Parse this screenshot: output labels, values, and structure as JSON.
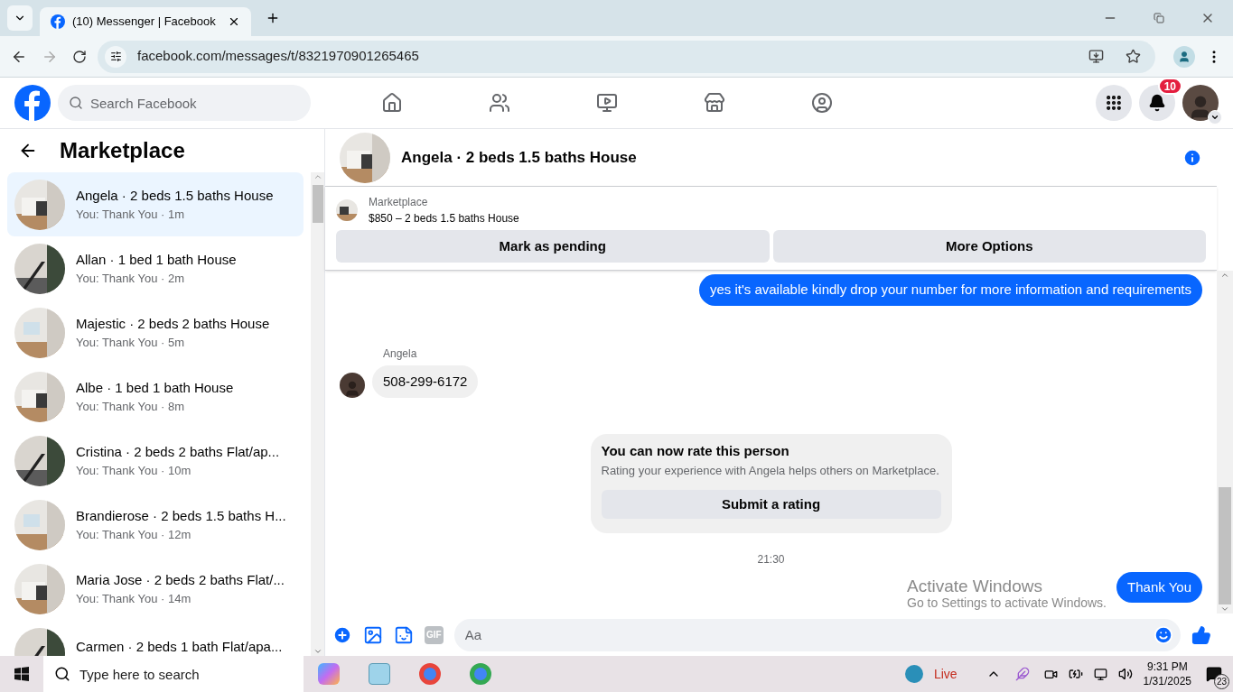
{
  "browser": {
    "tab_title": "(10) Messenger | Facebook",
    "url": "facebook.com/messages/t/8321970901265465"
  },
  "header": {
    "search_placeholder": "Search Facebook",
    "notification_count": "10"
  },
  "sidebar": {
    "title": "Marketplace",
    "conversations": [
      {
        "name": "Angela · 2 beds 1.5 baths House",
        "preview": "You: Thank You · 1m",
        "selected": true
      },
      {
        "name": "Allan · 1 bed 1 bath House",
        "preview": "You: Thank You · 2m",
        "selected": false
      },
      {
        "name": "Majestic · 2 beds 2 baths House",
        "preview": "You: Thank You · 5m",
        "selected": false
      },
      {
        "name": "Albe · 1 bed 1 bath House",
        "preview": "You: Thank You · 8m",
        "selected": false
      },
      {
        "name": "Cristina · 2 beds 2 baths Flat/ap...",
        "preview": "You: Thank You · 10m",
        "selected": false
      },
      {
        "name": "Brandierose · 2 beds 1.5 baths H...",
        "preview": "You: Thank You · 12m",
        "selected": false
      },
      {
        "name": "Maria Jose · 2 beds 2 baths Flat/...",
        "preview": "You: Thank You · 14m",
        "selected": false
      },
      {
        "name": "Carmen · 2 beds 1 bath Flat/apa...",
        "selected": false
      }
    ]
  },
  "chat": {
    "title": "Angela · 2 beds 1.5 baths House",
    "listing": {
      "label": "Marketplace",
      "title": "$850 – 2 beds 1.5 baths House"
    },
    "actions": [
      "Mark as pending",
      "More Options"
    ],
    "messages": [
      {
        "kind": "outgoing",
        "text": "yes it's available kindly drop your number for more information and requirements"
      },
      {
        "kind": "incoming",
        "sender": "Angela",
        "text": "508-299-6172"
      },
      {
        "kind": "rating",
        "title": "You can now rate this person",
        "text": "Rating your experience with Angela helps others on Marketplace.",
        "button": "Submit a rating"
      },
      {
        "kind": "timestamp",
        "text": "21:30"
      },
      {
        "kind": "outgoing",
        "text": "Thank You"
      }
    ],
    "composer_placeholder": "Aa",
    "gif_label": "GIF"
  },
  "activation_notice": {
    "title": "Activate Windows",
    "text": "Go to Settings to activate Windows."
  },
  "taskbar": {
    "search_placeholder": "Type here to search",
    "live": "Live",
    "time": "9:31 PM",
    "date": "1/31/2025",
    "notification_count": "23"
  }
}
